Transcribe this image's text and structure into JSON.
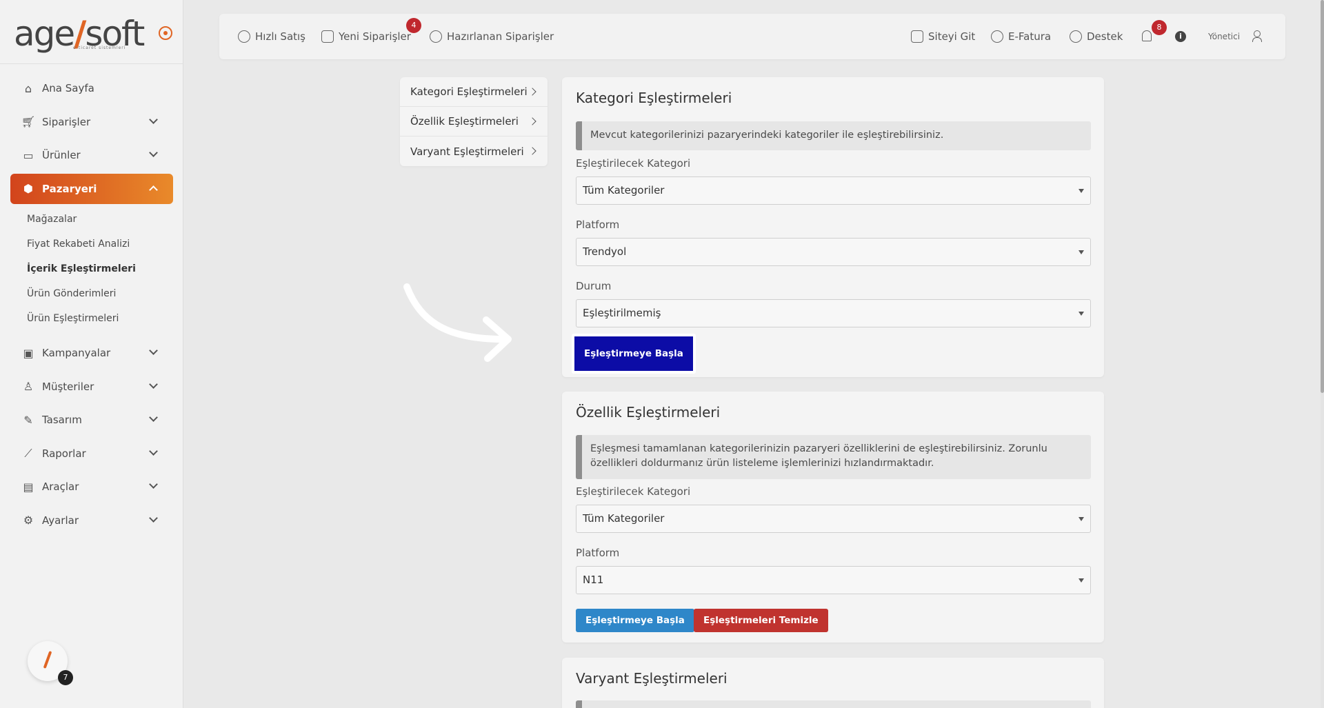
{
  "logo": {
    "text_a": "age",
    "text_b": "soft",
    "subtitle": "e-ticaret sistemleri"
  },
  "sidebar": {
    "items": [
      {
        "label": "Ana Sayfa",
        "icon": "home-icon"
      },
      {
        "label": "Siparişler",
        "icon": "cart-icon"
      },
      {
        "label": "Ürünler",
        "icon": "book-icon"
      },
      {
        "label": "Pazaryeri",
        "icon": "box-icon"
      },
      {
        "label": "Kampanyalar",
        "icon": "gift-icon"
      },
      {
        "label": "Müşteriler",
        "icon": "user-icon"
      },
      {
        "label": "Tasarım",
        "icon": "edit-icon"
      },
      {
        "label": "Raporlar",
        "icon": "chart-icon"
      },
      {
        "label": "Araçlar",
        "icon": "clipboard-icon"
      },
      {
        "label": "Ayarlar",
        "icon": "settings-icon"
      }
    ],
    "sub_items": [
      "Mağazalar",
      "Fiyat Rekabeti Analizi",
      "İçerik Eşleştirmeleri",
      "Ürün Gönderimleri",
      "Ürün Eşleştirmeleri"
    ],
    "pencil_count": "7"
  },
  "topbar": {
    "quick_sale": "Hızlı Satış",
    "new_orders": "Yeni Siparişler",
    "new_orders_badge": "4",
    "prepared_orders": "Hazırlanan Siparişler",
    "go_site": "Siteyi Git",
    "e_invoice": "E-Fatura",
    "support": "Destek",
    "notif_badge": "8",
    "info": "i",
    "user": "Yönetici"
  },
  "submenu": [
    "Kategori Eşleştirmeleri",
    "Özellik Eşleştirmeleri",
    "Varyant Eşleştirmeleri"
  ],
  "category_card": {
    "title": "Kategori Eşleştirmeleri",
    "info": "Mevcut kategorilerinizi pazaryerindeki kategoriler ile eşleştirebilirsiniz.",
    "category_label": "Eşleştirilecek Kategori",
    "category_value": "Tüm Kategoriler",
    "platform_label": "Platform",
    "platform_value": "Trendyol",
    "status_label": "Durum",
    "status_value": "Eşleştirilmemiş",
    "start_button": "Eşleştirmeye Başla"
  },
  "feature_card": {
    "title": "Özellik Eşleştirmeleri",
    "info": "Eşleşmesi tamamlanan kategorilerinizin pazaryeri özelliklerini de eşleştirebilirsiniz. Zorunlu özellikleri doldurmanız ürün listeleme işlemlerinizi hızlandırmaktadır.",
    "category_label": "Eşleştirilecek Kategori",
    "category_value": "Tüm Kategoriler",
    "platform_label": "Platform",
    "platform_value": "N11",
    "start_button": "Eşleştirmeye Başla",
    "clear_button": "Eşleştirmeleri Temizle"
  },
  "variant_card": {
    "title": "Varyant Eşleştirmeleri"
  }
}
